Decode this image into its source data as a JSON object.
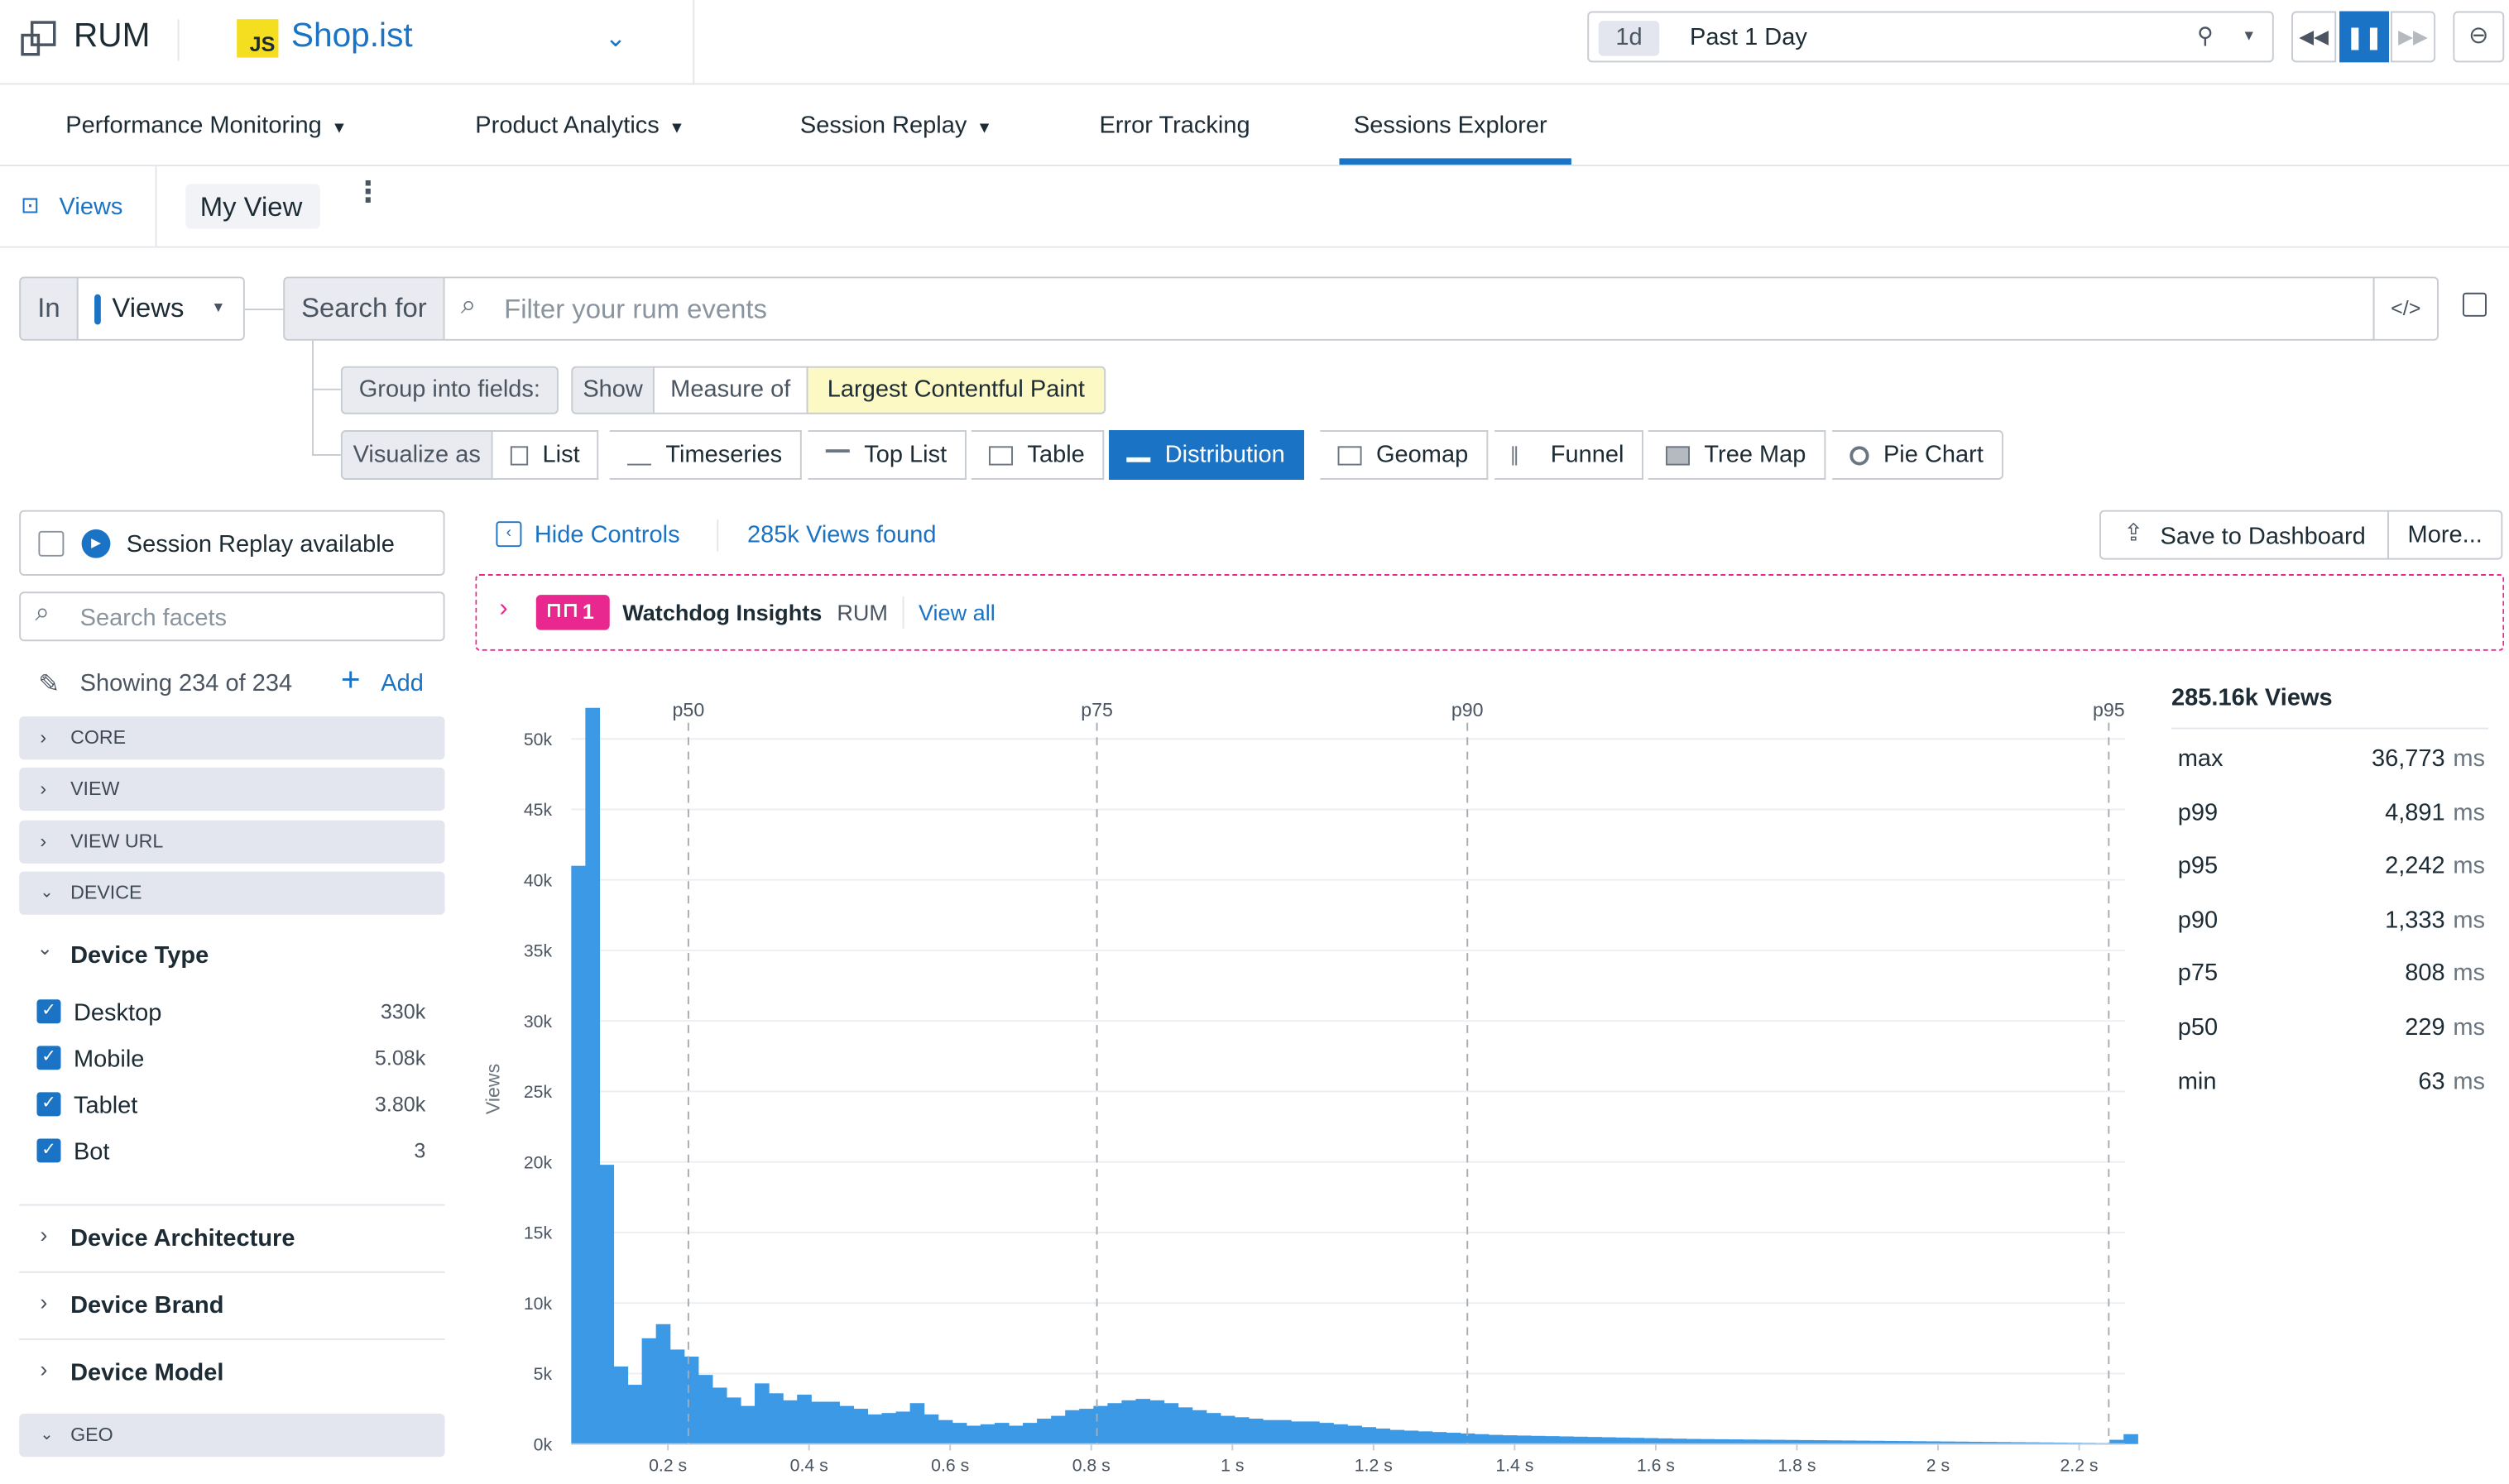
{
  "header": {
    "app_title": "RUM",
    "app_logo_badge": "JS",
    "app_name": "Shop.ist",
    "time_badge": "1d",
    "time_label": "Past 1 Day"
  },
  "nav": {
    "tabs": [
      {
        "label": "Performance Monitoring",
        "has_menu": true
      },
      {
        "label": "Product Analytics",
        "has_menu": true
      },
      {
        "label": "Session Replay",
        "has_menu": true
      },
      {
        "label": "Error Tracking",
        "has_menu": false
      },
      {
        "label": "Sessions Explorer",
        "has_menu": false,
        "active": true
      }
    ]
  },
  "views_bar": {
    "views_label": "Views",
    "current_view": "My View"
  },
  "query": {
    "in_label": "In",
    "in_value": "Views",
    "search_for_label": "Search for",
    "search_placeholder": "Filter your rum events",
    "group_label": "Group into fields:",
    "show_label": "Show",
    "measure_of_label": "Measure of",
    "measure_value": "Largest Contentful Paint",
    "visualize_label": "Visualize as",
    "visualizations": [
      "List",
      "Timeseries",
      "Top List",
      "Table",
      "Distribution",
      "Geomap",
      "Funnel",
      "Tree Map",
      "Pie Chart"
    ],
    "active_visualization": "Distribution"
  },
  "sidebar": {
    "session_replay_label": "Session Replay available",
    "search_placeholder": "Search facets",
    "showing_text": "Showing 234 of 234",
    "add_label": "Add",
    "groups": [
      "CORE",
      "VIEW",
      "VIEW URL",
      "DEVICE"
    ],
    "device_type": {
      "title": "Device Type",
      "items": [
        {
          "label": "Desktop",
          "count": "330k",
          "checked": true
        },
        {
          "label": "Mobile",
          "count": "5.08k",
          "checked": true
        },
        {
          "label": "Tablet",
          "count": "3.80k",
          "checked": true
        },
        {
          "label": "Bot",
          "count": "3",
          "checked": true
        }
      ]
    },
    "collapsed_facets": [
      "Device Architecture",
      "Device Brand",
      "Device Model"
    ],
    "geo_group": "GEO"
  },
  "results": {
    "hide_controls_label": "Hide Controls",
    "found_text": "285k Views found",
    "save_dashboard_label": "Save to Dashboard",
    "more_label": "More...",
    "watchdog_count": "1",
    "watchdog_title": "Watchdog Insights",
    "watchdog_scope": "RUM",
    "watchdog_view_all": "View all"
  },
  "stats": {
    "total": "285.16k Views",
    "rows": [
      {
        "label": "max",
        "value": "36,773",
        "unit": "ms"
      },
      {
        "label": "p99",
        "value": "4,891",
        "unit": "ms"
      },
      {
        "label": "p95",
        "value": "2,242",
        "unit": "ms"
      },
      {
        "label": "p90",
        "value": "1,333",
        "unit": "ms"
      },
      {
        "label": "p75",
        "value": "808",
        "unit": "ms"
      },
      {
        "label": "p50",
        "value": "229",
        "unit": "ms"
      },
      {
        "label": "min",
        "value": "63",
        "unit": "ms"
      }
    ]
  },
  "colors": {
    "accent": "#1a73c4",
    "bar": "#3b99e6",
    "watchdog": "#e8288e",
    "highlight": "#fdf9c4"
  },
  "chart_data": {
    "type": "bar",
    "ylabel": "Views",
    "xlim": [
      0.063,
      2.265
    ],
    "ylim": [
      0,
      52500
    ],
    "x_ticks": [
      {
        "v": 0.2,
        "label": "0.2 s"
      },
      {
        "v": 0.4,
        "label": "0.4 s"
      },
      {
        "v": 0.6,
        "label": "0.6 s"
      },
      {
        "v": 0.8,
        "label": "0.8 s"
      },
      {
        "v": 1.0,
        "label": "1 s"
      },
      {
        "v": 1.2,
        "label": "1.2 s"
      },
      {
        "v": 1.4,
        "label": "1.4 s"
      },
      {
        "v": 1.6,
        "label": "1.6 s"
      },
      {
        "v": 1.8,
        "label": "1.8 s"
      },
      {
        "v": 2.0,
        "label": "2 s"
      },
      {
        "v": 2.2,
        "label": "2.2 s"
      }
    ],
    "y_ticks": [
      {
        "v": 0,
        "label": "0k"
      },
      {
        "v": 5000,
        "label": "5k"
      },
      {
        "v": 10000,
        "label": "10k"
      },
      {
        "v": 15000,
        "label": "15k"
      },
      {
        "v": 20000,
        "label": "20k"
      },
      {
        "v": 25000,
        "label": "25k"
      },
      {
        "v": 30000,
        "label": "30k"
      },
      {
        "v": 35000,
        "label": "35k"
      },
      {
        "v": 40000,
        "label": "40k"
      },
      {
        "v": 45000,
        "label": "45k"
      },
      {
        "v": 50000,
        "label": "50k"
      }
    ],
    "percentiles": [
      {
        "label": "p50",
        "x": 0.229
      },
      {
        "label": "p75",
        "x": 0.808
      },
      {
        "label": "p90",
        "x": 1.333
      },
      {
        "label": "p95",
        "x": 2.242
      }
    ],
    "bin_width": 0.02,
    "bin_start": 0.063,
    "values": [
      41000,
      52200,
      19800,
      5500,
      4200,
      7500,
      8500,
      6700,
      6200,
      4900,
      4000,
      3300,
      2700,
      4300,
      3600,
      3100,
      3500,
      3000,
      3000,
      2700,
      2500,
      2100,
      2200,
      2300,
      2900,
      2100,
      1700,
      1500,
      1300,
      1400,
      1500,
      1300,
      1500,
      1800,
      2000,
      2400,
      2500,
      2700,
      2900,
      3100,
      3200,
      3100,
      2900,
      2600,
      2400,
      2200,
      2000,
      1900,
      1800,
      1700,
      1700,
      1600,
      1600,
      1500,
      1400,
      1300,
      1200,
      1100,
      1000,
      950,
      900,
      850,
      800,
      750,
      700,
      650,
      620,
      600,
      580,
      560,
      540,
      520,
      500,
      480,
      460,
      440,
      420,
      400,
      380,
      360,
      350,
      340,
      330,
      320,
      310,
      300,
      290,
      280,
      270,
      260,
      250,
      240,
      230,
      220,
      210,
      200,
      190,
      180,
      170,
      160,
      150,
      140,
      130,
      120,
      110,
      100,
      90,
      80,
      70,
      300,
      700
    ]
  }
}
